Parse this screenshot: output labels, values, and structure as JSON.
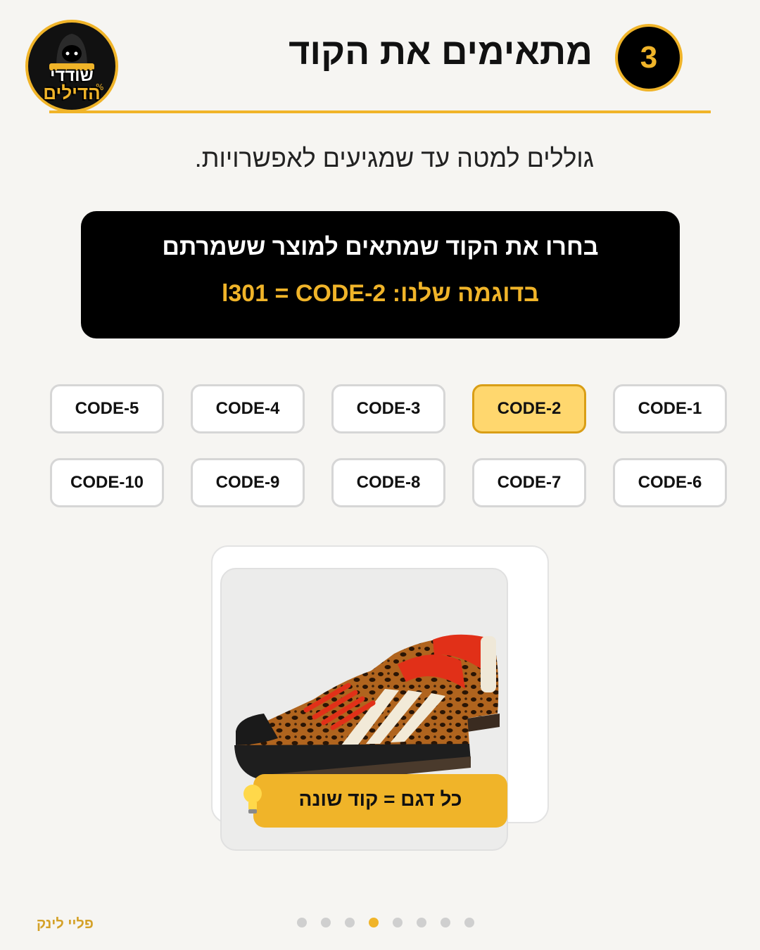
{
  "brand": {
    "logo_line1": "שודדי",
    "logo_line2": "הדילים",
    "footer": "פליי לינק"
  },
  "header": {
    "step_number": "3",
    "title": "מתאימים את הקוד"
  },
  "subtitle": "גוללים למטה עד שמגיעים לאפשרויות.",
  "info": {
    "line1": "בחרו את הקוד שמתאים למוצר ששמרתם",
    "line2": "בדוגמה שלנו: l301 = CODE-2"
  },
  "codes": [
    {
      "label": "CODE-1",
      "selected": false
    },
    {
      "label": "CODE-2",
      "selected": true
    },
    {
      "label": "CODE-3",
      "selected": false
    },
    {
      "label": "CODE-4",
      "selected": false
    },
    {
      "label": "CODE-5",
      "selected": false
    },
    {
      "label": "CODE-6",
      "selected": false
    },
    {
      "label": "CODE-7",
      "selected": false
    },
    {
      "label": "CODE-8",
      "selected": false
    },
    {
      "label": "CODE-9",
      "selected": false
    },
    {
      "label": "CODE-10",
      "selected": false
    }
  ],
  "tip": {
    "icon": "lightbulb-icon",
    "text": "כל דגם = קוד שונה"
  },
  "pagination": {
    "total": 8,
    "active_index": 3
  },
  "colors": {
    "accent": "#f0b429",
    "selected_fill": "#ffd76e",
    "background": "#f6f5f2"
  }
}
